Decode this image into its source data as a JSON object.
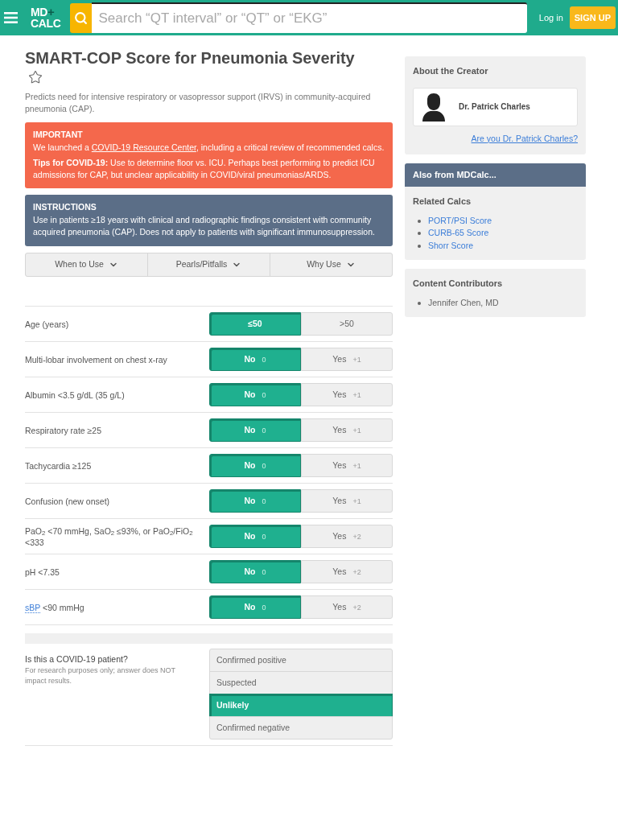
{
  "header": {
    "logo": {
      "top": "MD",
      "mark": "+",
      "bottom": "CALC"
    },
    "search": {
      "placeholder": "Search “QT interval” or “QT” or “EKG”"
    },
    "login": "Log in",
    "signup": "SIGN UP"
  },
  "calculator": {
    "title": "SMART-COP Score for Pneumonia Severity",
    "starred": false,
    "description": "Predicts need for intensive respiratory or vasopressor support (IRVS) in community-acquired pneumonia (CAP)."
  },
  "important": {
    "heading": "IMPORTANT",
    "text_before": "We launched a ",
    "link": "COVID-19 Resource Center",
    "text_after": ", including a critical review of recommended calcs.",
    "tips": "**Tips for COVID-19:** Use to determine floor vs. ICU. Perhaps best performing to predict ICU admissions for CAP, but unclear applicability in COVID/viral pneumonias/ARDS."
  },
  "instructions": {
    "heading": "INSTRUCTIONS",
    "text": "Use in patients ≥18 years with clinical and radiographic findings consistent with community acquired pneumonia (CAP). Does not apply to patients with significant immunosuppression."
  },
  "tabs": [
    {
      "label": "When to Use",
      "expanded": false
    },
    {
      "label": "Pearls/Pitfalls",
      "expanded": false
    },
    {
      "label": "Why Use",
      "expanded": false
    }
  ],
  "rows": [
    {
      "label": "Age (years)",
      "options": [
        {
          "label": "≤50",
          "selected": true
        },
        {
          "label": ">50",
          "selected": false
        }
      ]
    },
    {
      "label": "Multi-lobar involvement on chest x-ray",
      "options": [
        {
          "label": "No",
          "points": "0",
          "selected": true
        },
        {
          "label": "Yes",
          "points": "+1",
          "selected": false
        }
      ]
    },
    {
      "label": "Albumin <3.5 g/dL (35 g/L)",
      "options": [
        {
          "label": "No",
          "points": "0",
          "selected": true
        },
        {
          "label": "Yes",
          "points": "+1",
          "selected": false
        }
      ]
    },
    {
      "label": "Respiratory rate ≥25",
      "options": [
        {
          "label": "No",
          "points": "0",
          "selected": true
        },
        {
          "label": "Yes",
          "points": "+1",
          "selected": false
        }
      ]
    },
    {
      "label": "Tachycardia ≥125",
      "options": [
        {
          "label": "No",
          "points": "0",
          "selected": true
        },
        {
          "label": "Yes",
          "points": "+1",
          "selected": false
        }
      ]
    },
    {
      "label": "Confusion (new onset)",
      "options": [
        {
          "label": "No",
          "points": "0",
          "selected": true
        },
        {
          "label": "Yes",
          "points": "+1",
          "selected": false
        }
      ]
    },
    {
      "label": "PaO$_{2}$ <70 mmHg, SaO$_{2}$ ≤93%, or PaO$_{2}$/FiO$_{2}$ <333",
      "options": [
        {
          "label": "No",
          "points": "0",
          "selected": true
        },
        {
          "label": "Yes",
          "points": "+2",
          "selected": false
        }
      ]
    },
    {
      "label": "pH <7.35",
      "options": [
        {
          "label": "No",
          "points": "0",
          "selected": true
        },
        {
          "label": "Yes",
          "points": "+2",
          "selected": false
        }
      ]
    },
    {
      "term": "sBP",
      "label": "<90 mmHg",
      "options": [
        {
          "label": "No",
          "points": "0",
          "selected": true
        },
        {
          "label": "Yes",
          "points": "+2",
          "selected": false
        }
      ]
    }
  ],
  "covid": {
    "question": "Is this a COVID-19 patient?",
    "note": "For research purposes only; answer does NOT impact results.",
    "options": [
      {
        "label": "Confirmed positive",
        "selected": false
      },
      {
        "label": "Suspected",
        "selected": false
      },
      {
        "label": "Unlikely",
        "selected": true
      },
      {
        "label": "Confirmed negative",
        "selected": false
      }
    ]
  },
  "sidebar": {
    "creator": {
      "title": "About the Creator",
      "name": "Dr. Patrick Charles",
      "claim_link": "Are you Dr. Patrick Charles?"
    },
    "also": {
      "title": "Also from MDCalc...",
      "section": "Related Calcs",
      "links": [
        "PORT/PSI Score",
        "CURB-65 Score",
        "Shorr Score"
      ]
    },
    "contributors": {
      "title": "Content Contributors",
      "names": [
        "Jennifer Chen, MD"
      ]
    }
  }
}
